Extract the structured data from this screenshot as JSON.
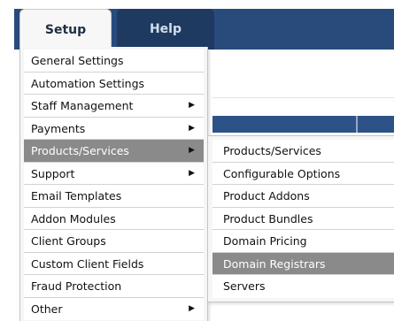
{
  "nav": {
    "tabs": [
      {
        "label": "Setup",
        "active": true
      },
      {
        "label": "Help",
        "active": false
      }
    ]
  },
  "colors": {
    "nav_bar": "#284b7c",
    "help_tab": "#1e3a60",
    "highlight": "#8a8a8a"
  },
  "setup_menu": {
    "items": [
      {
        "label": "General Settings",
        "has_submenu": false
      },
      {
        "label": "Automation Settings",
        "has_submenu": false
      },
      {
        "label": "Staff Management",
        "has_submenu": true
      },
      {
        "label": "Payments",
        "has_submenu": true
      },
      {
        "label": "Products/Services",
        "has_submenu": true,
        "highlighted": true
      },
      {
        "label": "Support",
        "has_submenu": true
      },
      {
        "label": "Email Templates",
        "has_submenu": false
      },
      {
        "label": "Addon Modules",
        "has_submenu": false
      },
      {
        "label": "Client Groups",
        "has_submenu": false
      },
      {
        "label": "Custom Client Fields",
        "has_submenu": false
      },
      {
        "label": "Fraud Protection",
        "has_submenu": false
      },
      {
        "label": "Other",
        "has_submenu": true
      }
    ],
    "submenu_arrow": "▶"
  },
  "products_submenu": {
    "items": [
      {
        "label": "Products/Services"
      },
      {
        "label": "Configurable Options"
      },
      {
        "label": "Product Addons"
      },
      {
        "label": "Product Bundles"
      },
      {
        "label": "Domain Pricing"
      },
      {
        "label": "Domain Registrars",
        "highlighted": true
      },
      {
        "label": "Servers"
      }
    ]
  }
}
